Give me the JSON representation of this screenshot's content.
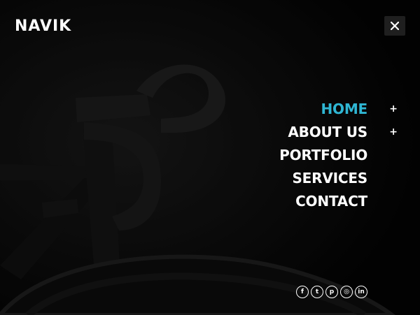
{
  "brand": {
    "logo_text": "NAVIK"
  },
  "menu": {
    "close_icon": "close-icon",
    "items": [
      {
        "label": "HOME",
        "active": true,
        "has_submenu": true
      },
      {
        "label": "ABOUT US",
        "active": false,
        "has_submenu": true
      },
      {
        "label": "PORTFOLIO",
        "active": false,
        "has_submenu": false
      },
      {
        "label": "SERVICES",
        "active": false,
        "has_submenu": false
      },
      {
        "label": "CONTACT",
        "active": false,
        "has_submenu": false
      }
    ],
    "submenu_toggle": "+"
  },
  "social": [
    {
      "name": "facebook",
      "glyph": "f"
    },
    {
      "name": "twitter",
      "glyph": "t"
    },
    {
      "name": "pinterest",
      "glyph": "p"
    },
    {
      "name": "instagram",
      "glyph": "◎"
    },
    {
      "name": "linkedin",
      "glyph": "in"
    }
  ],
  "colors": {
    "accent": "#2fb6d3",
    "background": "#050505",
    "text": "#ffffff"
  }
}
